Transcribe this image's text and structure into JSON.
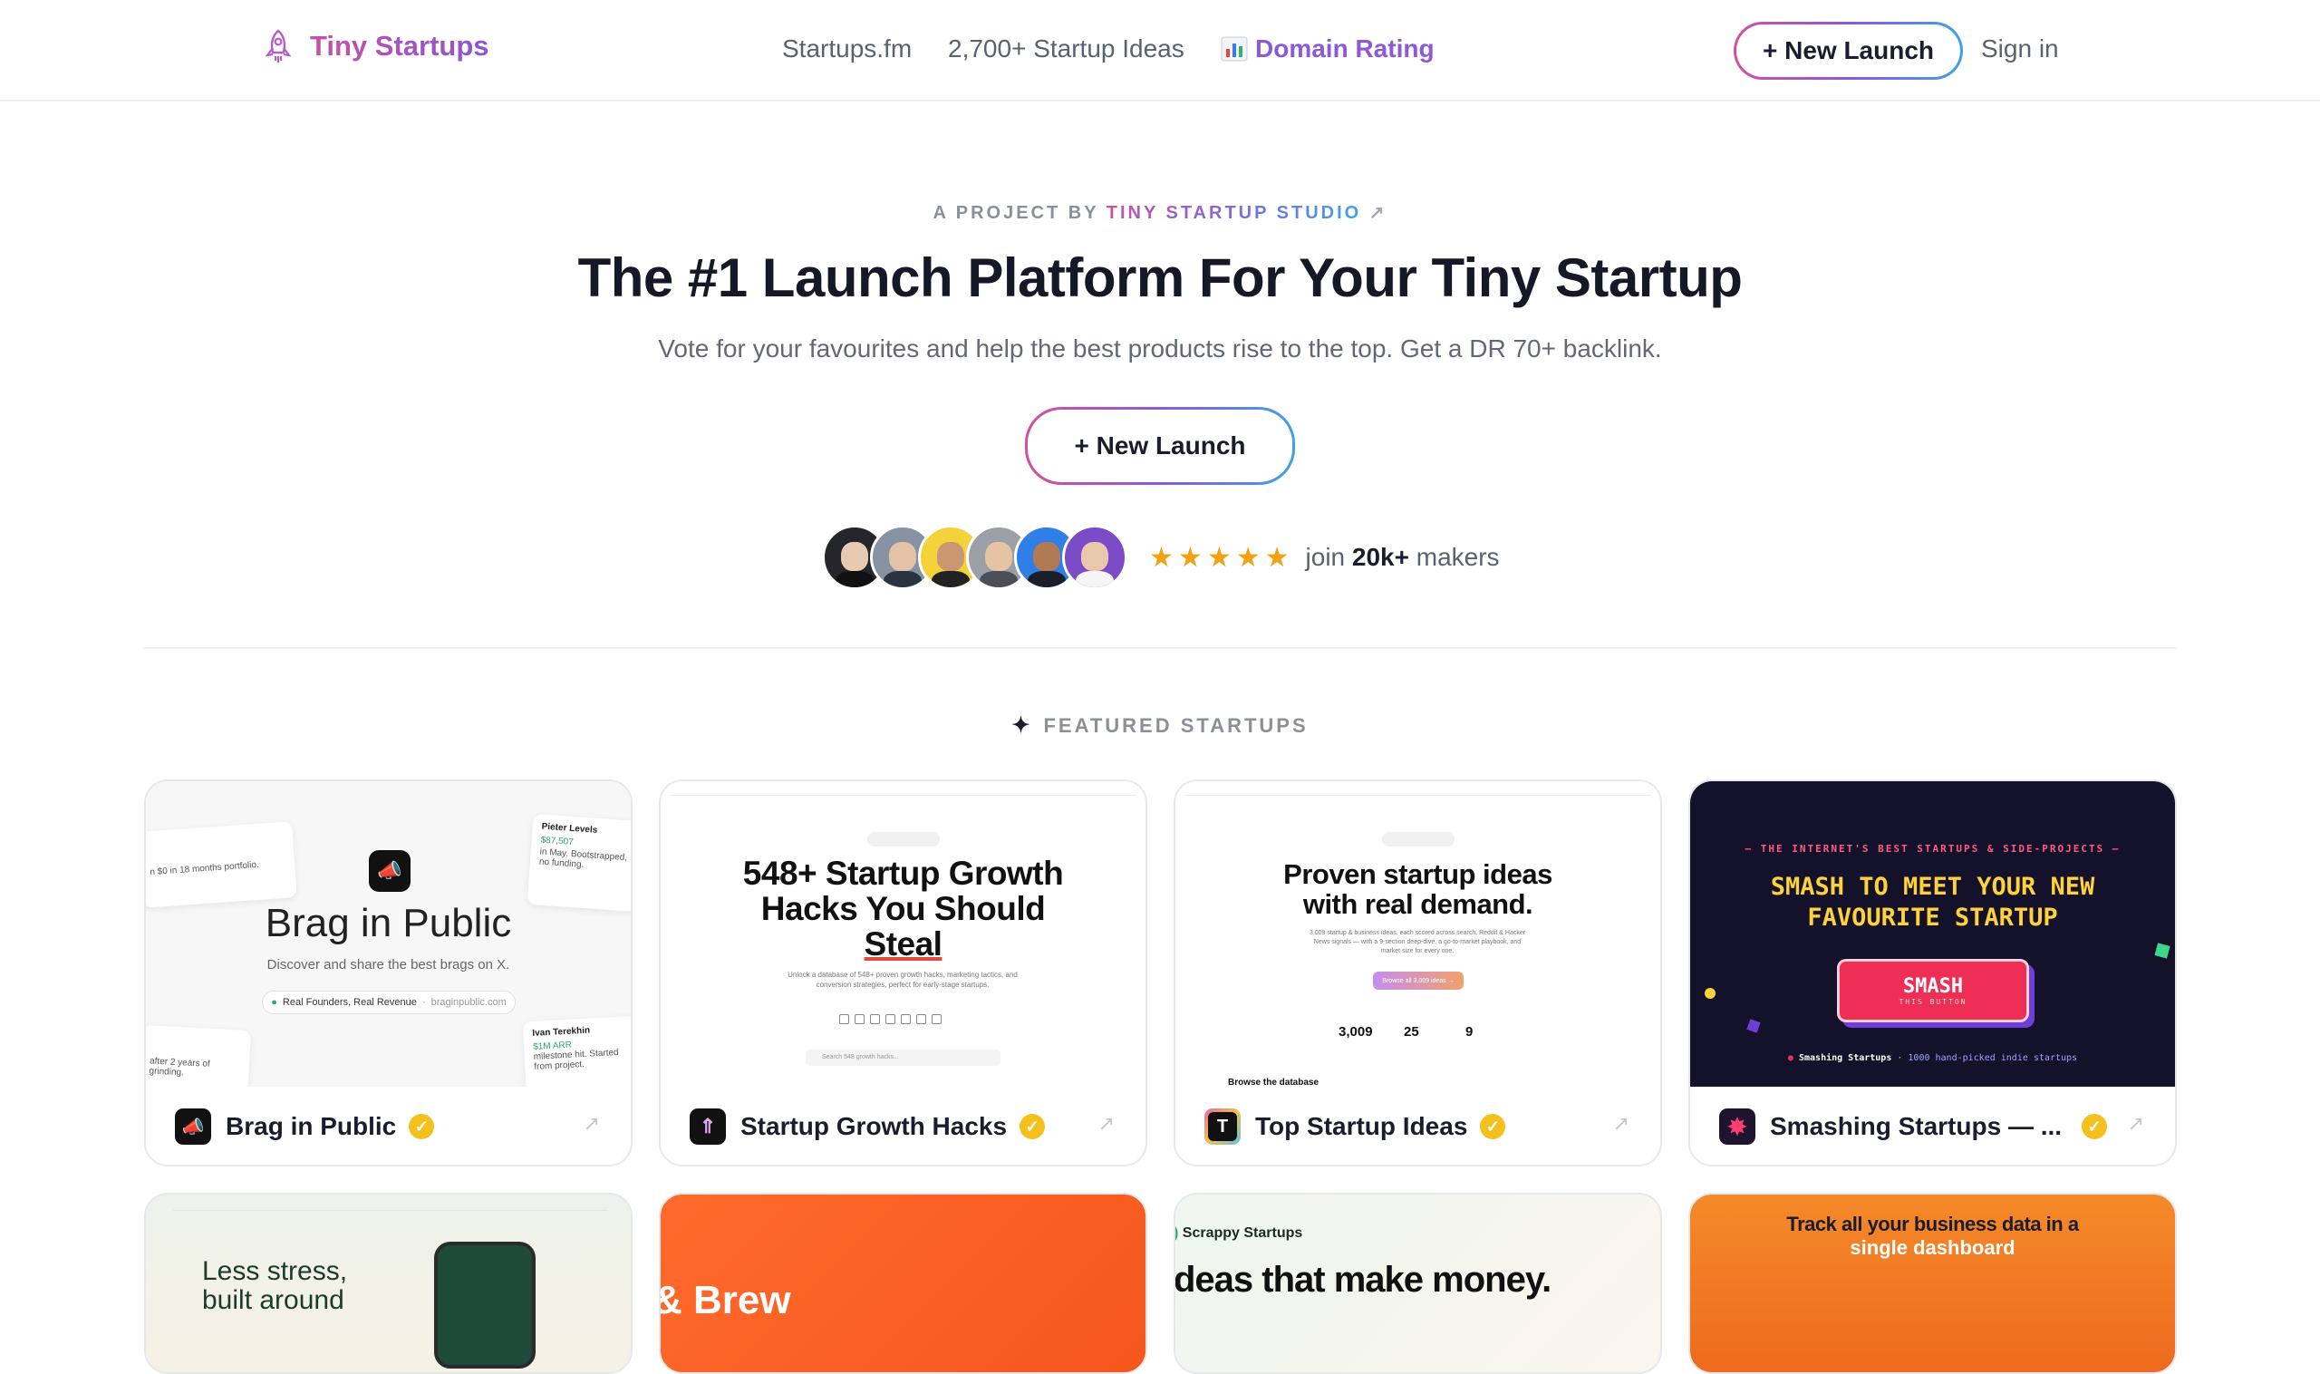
{
  "header": {
    "brand": "Tiny Startups",
    "nav": [
      "Startups.fm",
      "2,700+ Startup Ideas"
    ],
    "domain_rating": "Domain Rating",
    "new_launch": "+ New Launch",
    "sign_in": "Sign in"
  },
  "hero": {
    "eyebrow_prefix": "A PROJECT BY",
    "eyebrow_studio": "TINY STARTUP STUDIO",
    "title": "The #1 Launch Platform For Your Tiny Startup",
    "subtitle": "Vote for your favourites and help the best products rise to the top. Get a DR 70+ backlink.",
    "cta": "+ New Launch",
    "join_prefix": "join",
    "join_count": "20k+",
    "join_suffix": "makers",
    "rating_stars": 5
  },
  "featured": {
    "heading": "FEATURED STARTUPS",
    "cards": [
      {
        "name": "Brag in Public",
        "thumb_title": "Brag in Public",
        "thumb_sub": "Discover and share the best brags on X.",
        "thumb_pill": "Real Founders, Real Revenue",
        "thumb_url": "braginpublic.com",
        "note1_text": "n $0 in 18 months portfolio.",
        "note2_name": "Pieter Levels",
        "note2_amount": "$87,507",
        "note2_text": "in May. Bootstrapped, no funding.",
        "note3_text": "after 2 years of grinding.",
        "note4_name": "Ivan Terekhin",
        "note4_amount": "$1M ARR",
        "note4_text": "milestone hit. Started from project."
      },
      {
        "name": "Startup Growth Hacks",
        "thumb_line1": "548+ Startup Growth",
        "thumb_line2": "Hacks You Should",
        "thumb_line3": "Steal",
        "thumb_sub": "Unlock a database of 548+ proven growth hacks, marketing tactics, and conversion strategies, perfect for early-stage startups.",
        "thumb_search": "Search 548 growth hacks..."
      },
      {
        "name": "Top Startup Ideas",
        "thumb_line1": "Proven startup ideas",
        "thumb_line2": "with real demand.",
        "thumb_sub": "3,009 startup & business ideas, each scored across search, Reddit & Hacker News signals — with a 9-section deep-dive, a go-to-market playbook, and market size for every one.",
        "thumb_btn": "Browse all 3,009 ideas →",
        "stat1": "3,009",
        "stat2": "25",
        "stat3": "9",
        "thumb_bottom": "Browse the database"
      },
      {
        "name": "Smashing Startups — ...",
        "thumb_kicker": "— THE INTERNET'S BEST STARTUPS & SIDE-PROJECTS —",
        "thumb_line1": "SMASH TO MEET YOUR NEW",
        "thumb_line2": "FAVOURITE STARTUP",
        "thumb_btn": "SMASH",
        "thumb_btn_sub": "THIS BUTTON",
        "thumb_footer_a": "Smashing Startups",
        "thumb_footer_b": "· 1000 hand-picked indie startups"
      }
    ],
    "row2": [
      {
        "text_a": "Less stress,",
        "text_b": "built around"
      },
      {
        "text_a": "Brew"
      },
      {
        "brand": "Scrappy Startups",
        "text_a": "deas that make money."
      },
      {
        "text_a": "Track all your business data in a",
        "text_b": "single dashboard"
      }
    ]
  },
  "colors": {
    "brand_pink": "#c850a8",
    "brand_purple": "#8a5ad8",
    "brand_blue": "#3fa2e6",
    "verified_gold": "#f4c01e",
    "star": "#f2a20f"
  },
  "icons": [
    "rocket-icon",
    "chart-icon",
    "star-icon",
    "verified-check-icon",
    "external-arrow-icon",
    "sparkle-icon"
  ]
}
